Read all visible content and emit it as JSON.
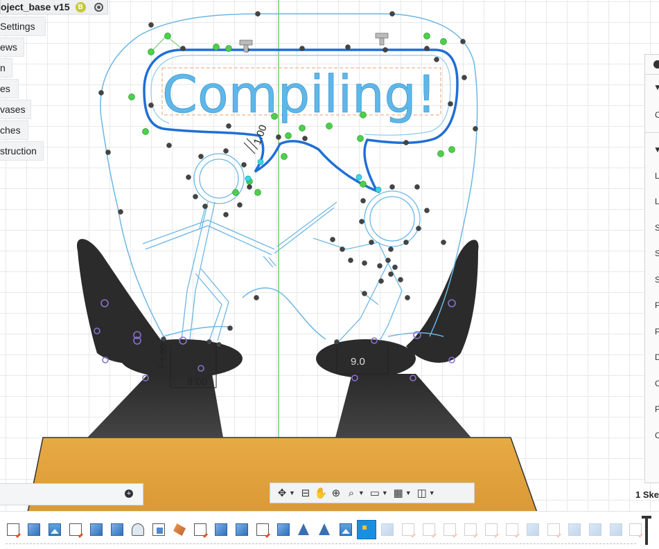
{
  "document": {
    "tab_title": "oject_base v15",
    "badge": "B"
  },
  "browser": {
    "items": [
      "Settings",
      "ews",
      "n",
      "es",
      "vases",
      "ches",
      "struction"
    ]
  },
  "canvas": {
    "text_label": "Compiling!",
    "dim_vertical": "1.00",
    "dim_left_bottom": "9.00",
    "dim_right_bottom": "9.0",
    "dim_left_side": "1.00"
  },
  "panel": {
    "section_a_char": "C",
    "rows": [
      "L",
      "L",
      "S",
      "S",
      "S",
      "P",
      "P",
      "D",
      "C",
      "P",
      "C"
    ]
  },
  "sketch_palette_label": "1 Ske",
  "nav_toolbar": {
    "icons": [
      "orbit-icon",
      "look-at-icon",
      "pan-hand-icon",
      "zoom-icon",
      "fit-icon",
      "display-settings-icon",
      "grid-icon",
      "viewports-icon"
    ]
  },
  "timeline": {
    "items": [
      "sketch",
      "body",
      "image",
      "sketch",
      "body",
      "body",
      "shell",
      "combine",
      "paint",
      "sketch",
      "body",
      "body",
      "sketch",
      "body",
      "mirror",
      "mirror",
      "image",
      "active",
      "faded-body",
      "faded-sketch",
      "faded-sketch",
      "faded-sketch",
      "faded-sketch",
      "faded-body",
      "faded-sketch",
      "faded-sketch",
      "faded-body",
      "faded-body",
      "faded-body",
      "faded-sketch"
    ]
  },
  "colors": {
    "accent": "#1a8fe0",
    "sketch_line": "#6cb6e4",
    "selected_profile": "#1e6fd6",
    "label_text": "#5fb7e8",
    "base_orange": "#e6a741",
    "dark_body": "#2b2b2b",
    "origin_axis": "#5cc85c"
  }
}
